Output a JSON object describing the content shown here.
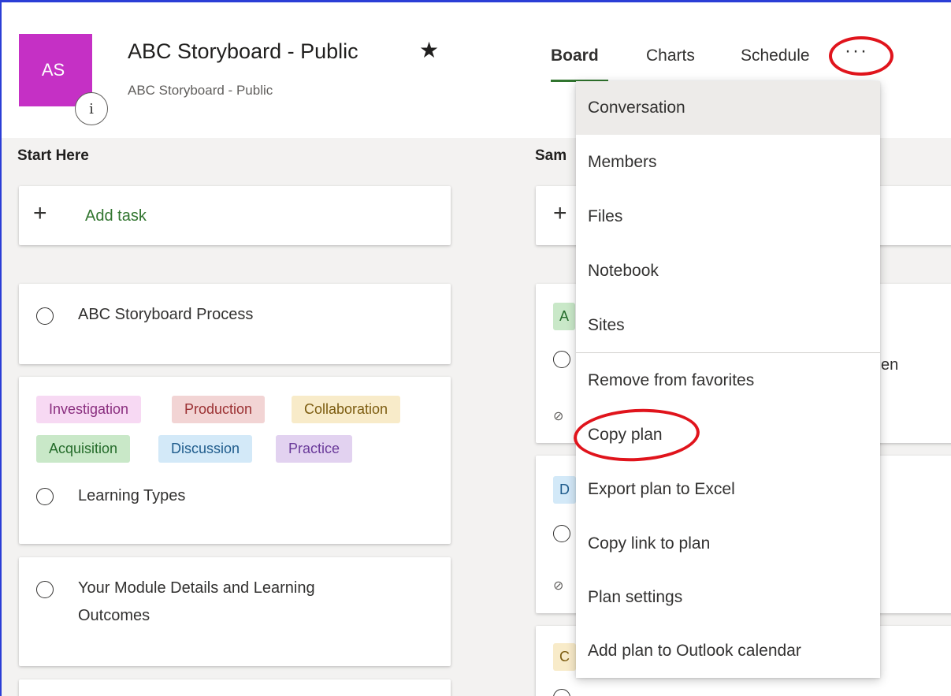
{
  "header": {
    "avatar_initials": "AS",
    "info_icon": "i",
    "title": "ABC Storyboard - Public",
    "star_icon": "★",
    "subtitle": "ABC Storyboard - Public",
    "tabs": [
      {
        "label": "Board"
      },
      {
        "label": "Charts"
      },
      {
        "label": "Schedule"
      }
    ],
    "more_icon": "···"
  },
  "colors": {
    "avatar": "#c530c5",
    "accent_green": "#31752f",
    "annotation_red": "#e0141c"
  },
  "left_column": {
    "bucket_title": "Start Here",
    "add_task_icon": "+",
    "add_task_label": "Add task",
    "tasks": [
      {
        "title": "ABC Storyboard Process"
      },
      {
        "title": "Learning Types"
      },
      {
        "title": "Your Module Details and Learning",
        "title_line2": "Outcomes"
      }
    ],
    "tags": [
      {
        "label": "Investigation",
        "bg": "#f7d9f3",
        "fg": "#8a2e7f"
      },
      {
        "label": "Production",
        "bg": "#f2d4d4",
        "fg": "#9b3032"
      },
      {
        "label": "Collaboration",
        "bg": "#f8ebc9",
        "fg": "#7c5c10"
      },
      {
        "label": "Acquisition",
        "bg": "#c9e8c8",
        "fg": "#246b2a"
      },
      {
        "label": "Discussion",
        "bg": "#d3e9f8",
        "fg": "#1f5c8c"
      },
      {
        "label": "Practice",
        "bg": "#e2d2f0",
        "fg": "#6a3a9a"
      }
    ]
  },
  "right_column": {
    "bucket_title_partial": "Sam",
    "add_task_icon": "+",
    "tag_partial_1": "A",
    "tag_partial_2": "D",
    "tag_partial_3": "C",
    "text_partial": "en",
    "small_check_icon": "⊘"
  },
  "menu": {
    "items": [
      {
        "label": "Conversation"
      },
      {
        "label": "Members"
      },
      {
        "label": "Files"
      },
      {
        "label": "Notebook"
      },
      {
        "label": "Sites"
      },
      {
        "label": "Remove from favorites"
      },
      {
        "label": "Copy plan"
      },
      {
        "label": "Export plan to Excel"
      },
      {
        "label": "Copy link to plan"
      },
      {
        "label": "Plan settings"
      },
      {
        "label": "Add plan to Outlook calendar"
      }
    ]
  }
}
